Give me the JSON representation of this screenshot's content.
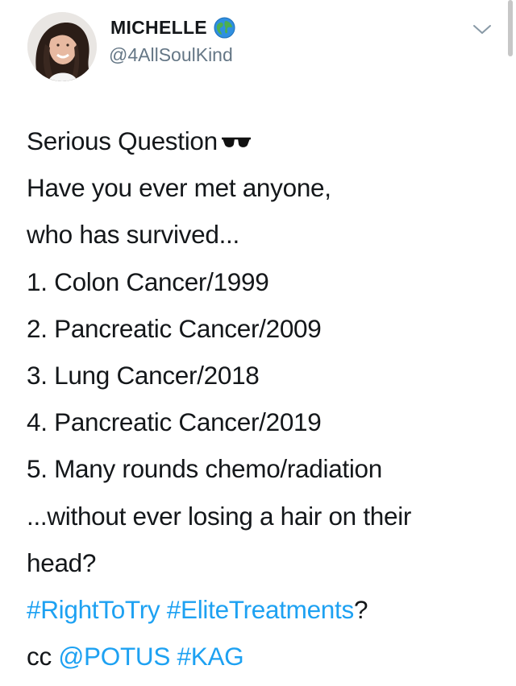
{
  "author": {
    "display_name": "MICHELLE",
    "handle": "@4AllSoulKind",
    "verified_icon": "globe-icon",
    "avatar": "avatar-photo"
  },
  "menu": {
    "icon": "chevron-down-icon"
  },
  "tweet": {
    "line1_text": "Serious Question",
    "line1_emoji": "sunglasses-icon",
    "line2": "Have you ever met anyone,",
    "line3": "who has survived...",
    "line4": "1. Colon Cancer/1999",
    "line5": "2. Pancreatic Cancer/2009",
    "line6": "3. Lung Cancer/2018",
    "line7": "4. Pancreatic Cancer/2019",
    "line8": "5. Many rounds chemo/radiation",
    "line9": "...without ever losing a hair on their",
    "line10": "head?",
    "hashtag_right_to_try": "#RightToTry",
    "space": " ",
    "hashtag_elite_treatments": "#EliteTreatments",
    "question_mark": "?",
    "cc_prefix": "cc ",
    "mention_potus": "@POTUS",
    "hashtag_kag": "#KAG"
  },
  "colors": {
    "link": "#1da1f2",
    "text": "#14171a",
    "secondary": "#657786"
  }
}
